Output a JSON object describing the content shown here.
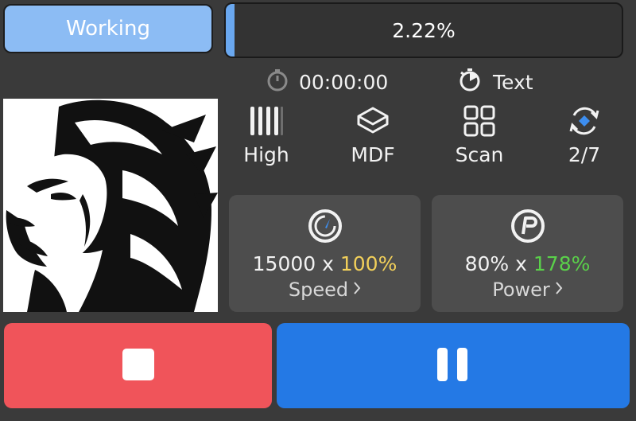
{
  "status": {
    "label": "Working"
  },
  "progress": {
    "text": "2.22%",
    "fraction": 0.0222
  },
  "timer": {
    "icon": "stopwatch-icon",
    "value": "00:00:00"
  },
  "mode": {
    "icon": "timer-icon",
    "label": "Text"
  },
  "stats": [
    {
      "icon": "quality-bars-icon",
      "label": "High"
    },
    {
      "icon": "material-cube-icon",
      "label": "MDF"
    },
    {
      "icon": "grid-scan-icon",
      "label": "Scan"
    },
    {
      "icon": "repeat-passes-icon",
      "label": "2/7"
    }
  ],
  "speed": {
    "icon": "speedometer-icon",
    "base": "15000 x ",
    "percent": "100%",
    "percent_color": "#f2d05a",
    "label": "Speed"
  },
  "power": {
    "icon": "power-p-icon",
    "base": "80% x ",
    "percent": "178%",
    "percent_color": "#5ad04a",
    "label": "Power"
  },
  "colors": {
    "background": "#3a3a3a",
    "status_button": "#8cbcf4",
    "stop_button": "#f0545a",
    "pause_button": "#2479e5",
    "card": "#4d4d4d"
  },
  "buttons": {
    "stop_icon": "stop-icon",
    "pause_icon": "pause-icon"
  },
  "preview": {
    "icon": "lion-engraving-image"
  }
}
